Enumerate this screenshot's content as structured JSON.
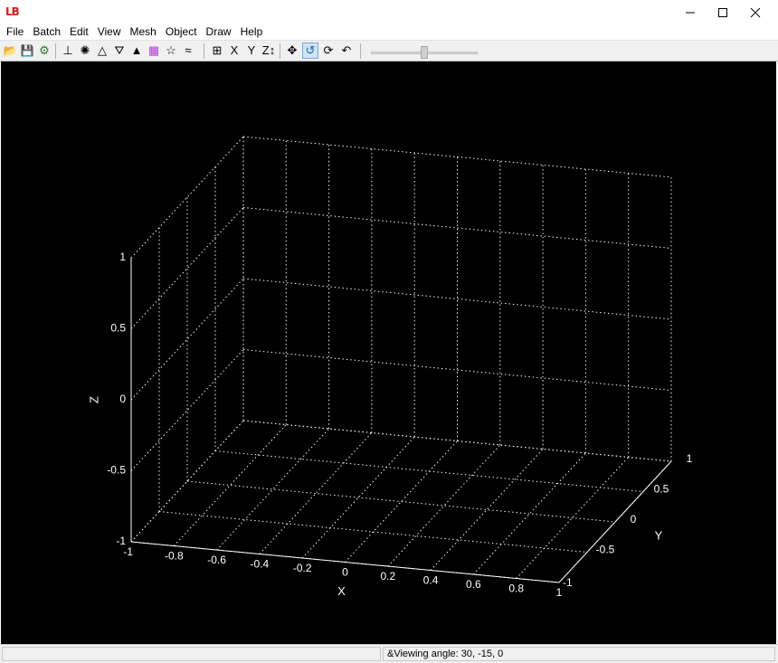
{
  "app": {
    "logo_text": "LB",
    "window_controls": [
      "minimize-icon",
      "maximize-icon",
      "close-icon"
    ]
  },
  "menu": [
    "File",
    "Batch",
    "Edit",
    "View",
    "Mesh",
    "Object",
    "Draw",
    "Help"
  ],
  "toolbar": {
    "buttons": [
      {
        "name": "open-folder-icon",
        "glyph": "📂",
        "active": false
      },
      {
        "name": "save-disk-icon",
        "glyph": "💾",
        "active": false
      },
      {
        "name": "batch-run-icon",
        "glyph": "⚙",
        "active": false
      },
      {
        "name": "axes-icon",
        "glyph": "⊥",
        "active": false
      },
      {
        "name": "light-icon",
        "glyph": "✺",
        "active": false
      },
      {
        "name": "mesh-wireframe-icon",
        "glyph": "△",
        "active": false
      },
      {
        "name": "mesh-dotted-icon",
        "glyph": "⛛",
        "active": false
      },
      {
        "name": "solid-cone-icon",
        "glyph": "▲",
        "active": false
      },
      {
        "name": "colormap-icon",
        "glyph": "▦",
        "active": false
      },
      {
        "name": "star-icon",
        "glyph": "☆",
        "active": false
      },
      {
        "name": "contour-icon",
        "glyph": "≈",
        "active": false
      },
      {
        "name": "bounding-box-icon",
        "glyph": "⊞",
        "active": false
      },
      {
        "name": "view-x-axis-icon",
        "glyph": "X",
        "active": false
      },
      {
        "name": "view-y-axis-icon",
        "glyph": "Y",
        "active": false
      },
      {
        "name": "view-z-axis-icon",
        "glyph": "Z↕",
        "active": false
      },
      {
        "name": "pan-move-icon",
        "glyph": "✥",
        "active": false
      },
      {
        "name": "rotate-icon",
        "glyph": "↺",
        "active": true
      },
      {
        "name": "rotate-3d-icon",
        "glyph": "⟳",
        "active": false
      },
      {
        "name": "reset-view-icon",
        "glyph": "↶",
        "active": false
      }
    ],
    "zoom_slider_value": 0.5
  },
  "chart_data": {
    "type": "3d-axes",
    "title": "",
    "xlabel": "X",
    "ylabel": "Y",
    "zlabel": "Z",
    "xlim": [
      -1,
      1
    ],
    "ylim": [
      -1,
      1
    ],
    "zlim": [
      -1,
      1
    ],
    "xticks": [
      "-1",
      "-0.8",
      "-0.6",
      "-0.4",
      "-0.2",
      "0",
      "0.2",
      "0.4",
      "0.6",
      "0.8",
      "1"
    ],
    "yticks": [
      "-1",
      "-0.5",
      "0",
      "0.5",
      "1"
    ],
    "zticks": [
      "-1",
      "-0.5",
      "0",
      "0.5",
      "1"
    ],
    "grid": true,
    "background": "#000000",
    "foreground": "#ffffff",
    "view_azimuth": 30,
    "view_elevation": -15
  },
  "status": {
    "left": "",
    "right": "&Viewing angle: 30, -15, 0"
  }
}
